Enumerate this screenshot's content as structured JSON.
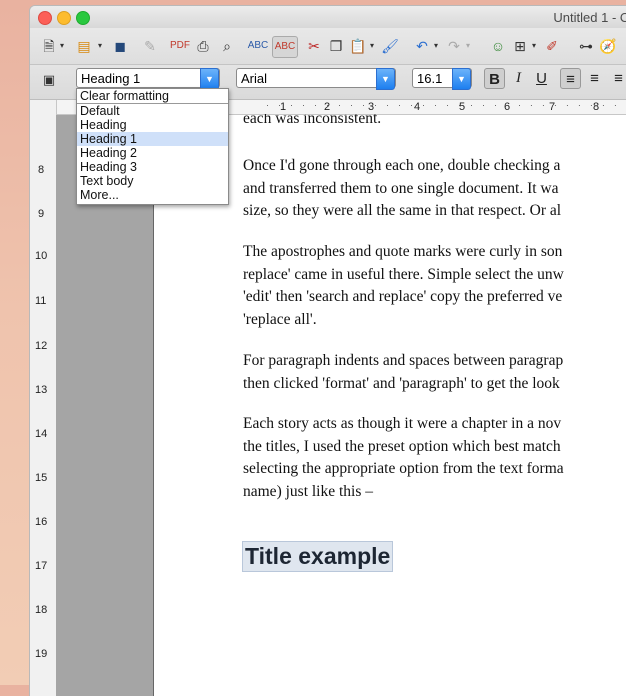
{
  "window": {
    "title": "Untitled 1 - O"
  },
  "toolbar1": {
    "icons": [
      "new-document-icon",
      "open-folder-icon",
      "save-icon",
      "edit-file-icon",
      "export-pdf-icon",
      "print-icon",
      "print-preview-icon",
      "spellcheck-icon",
      "autospellcheck-icon",
      "cut-icon",
      "copy-icon",
      "paste-icon",
      "clone-formatting-icon",
      "undo-icon",
      "redo-icon",
      "navigator-icon",
      "table-icon",
      "draw-functions-icon",
      "find-binoculars-icon",
      "compass-icon"
    ]
  },
  "toolbar2": {
    "paragraph_style": "Heading 1",
    "font_name": "Arial",
    "font_size": "16.1",
    "bold_label": "B",
    "italic_label": "I",
    "underline_label": "U"
  },
  "style_dropdown": {
    "items": [
      "Clear formatting",
      "Default",
      "Heading",
      "Heading 1",
      "Heading 2",
      "Heading 3",
      "Text body",
      "More..."
    ],
    "selected": "Heading 1"
  },
  "ruler": {
    "h_labels": [
      "1",
      "2",
      "3",
      "4",
      "5",
      "6",
      "7",
      "8"
    ],
    "v_labels": [
      "8",
      "9",
      "10",
      "11",
      "12",
      "13",
      "14",
      "15",
      "16",
      "17",
      "18",
      "19"
    ]
  },
  "document": {
    "lines_top": "each was inconsistent.",
    "para1": [
      "Once I'd gone through each one, double checking a",
      "and transferred them to one single document. It wa",
      "size, so they were all the same in that respect. Or al"
    ],
    "para2": [
      "The apostrophes and quote marks were curly in son",
      "replace' came in useful there. Simple select the unw",
      "'edit' then 'search and replace' copy the preferred ve",
      "'replace all'."
    ],
    "para3": [
      "For paragraph indents and spaces between paragrap",
      "then clicked 'format' and 'paragraph' to get the look"
    ],
    "para4": [
      "Each story acts as though it were a chapter in a nov",
      "the titles, I used the preset option which best match",
      "selecting the appropriate option from the text forma",
      "name) just like this –"
    ],
    "title_example": "Title example"
  }
}
